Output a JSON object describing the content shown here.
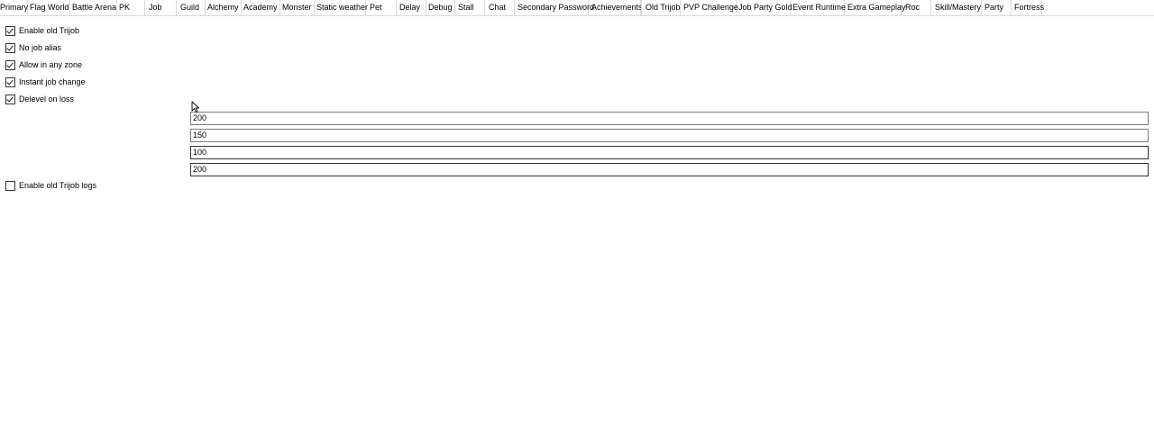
{
  "tabs": [
    {
      "label": "Primary",
      "active": false
    },
    {
      "label": "Flag World",
      "active": false
    },
    {
      "label": "Battle Arena",
      "active": false
    },
    {
      "label": "PK",
      "active": false
    },
    {
      "label": "Job",
      "active": false
    },
    {
      "label": "Guild",
      "active": false
    },
    {
      "label": "Alchemy",
      "active": false
    },
    {
      "label": "Academy",
      "active": false
    },
    {
      "label": "Monster",
      "active": false
    },
    {
      "label": "Static weather",
      "active": false
    },
    {
      "label": "Pet",
      "active": false
    },
    {
      "label": "Delay",
      "active": false
    },
    {
      "label": "Debug",
      "active": false
    },
    {
      "label": "Stall",
      "active": false
    },
    {
      "label": "Chat",
      "active": false
    },
    {
      "label": "Secondary Password",
      "active": false
    },
    {
      "label": "Achievements",
      "active": false
    },
    {
      "label": "Old Trijob",
      "active": true
    },
    {
      "label": "PVP Challenge",
      "active": false
    },
    {
      "label": "Job Party Gold",
      "active": false
    },
    {
      "label": "Event Runtime",
      "active": false
    },
    {
      "label": "Extra Gameplay",
      "active": false
    },
    {
      "label": "Roc",
      "active": false
    },
    {
      "label": "Skill/Mastery",
      "active": false
    },
    {
      "label": "Party",
      "active": false
    },
    {
      "label": "Fortress",
      "active": false
    }
  ],
  "options": {
    "enable_old_trijob": {
      "label": "Enable old Trijob",
      "checked": true
    },
    "no_job_alias": {
      "label": "No job alias",
      "checked": true
    },
    "allow_in_any_zone": {
      "label": "Allow in any zone",
      "checked": true
    },
    "instant_job_change": {
      "label": "Instant job change",
      "checked": true
    },
    "delevel_on_loss": {
      "label": "Delevel on loss",
      "checked": true
    },
    "enable_old_trijob_logs": {
      "label": "Enable old Trijob logs",
      "checked": false
    }
  },
  "fields": [
    {
      "value": "200"
    },
    {
      "value": "150"
    },
    {
      "value": "100"
    },
    {
      "value": "200"
    }
  ]
}
